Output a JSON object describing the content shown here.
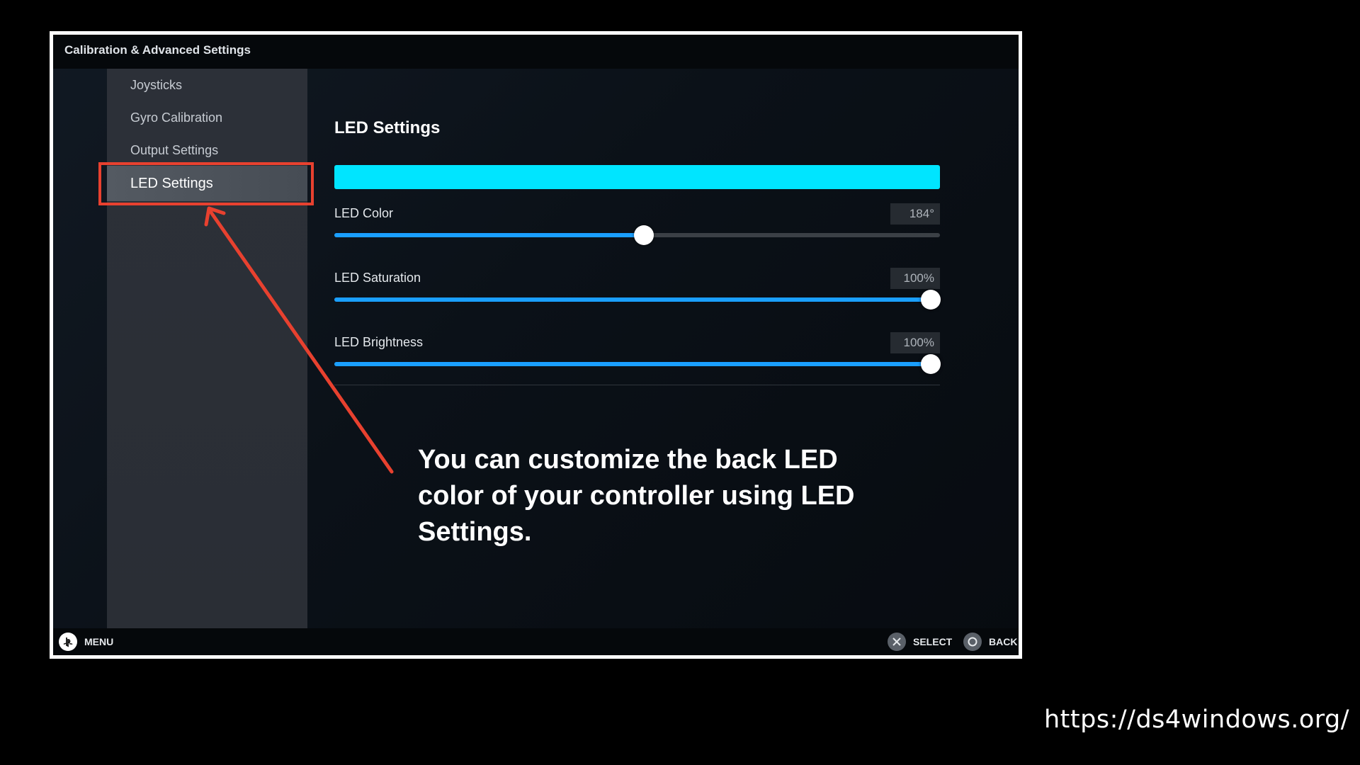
{
  "window": {
    "title": "Calibration & Advanced Settings"
  },
  "sidebar": {
    "items": [
      {
        "label": "Joysticks",
        "active": false
      },
      {
        "label": "Gyro Calibration",
        "active": false
      },
      {
        "label": "Output Settings",
        "active": false
      },
      {
        "label": "LED Settings",
        "active": true
      }
    ]
  },
  "main": {
    "section_title": "LED Settings",
    "preview_color": "#00e5ff",
    "sliders": [
      {
        "label": "LED Color",
        "value_text": "184°",
        "fraction": 0.511
      },
      {
        "label": "LED Saturation",
        "value_text": "100%",
        "fraction": 0.985
      },
      {
        "label": "LED Brightness",
        "value_text": "100%",
        "fraction": 0.985
      }
    ]
  },
  "annotation": {
    "caption": "You can customize the back LED color of your controller using LED Settings.",
    "highlight_color": "#e8412f"
  },
  "footer": {
    "menu_label": "MENU",
    "select_label": "SELECT",
    "back_label": "BACK",
    "menu_icon": "playstation-icon",
    "select_icon": "cross-button-icon",
    "back_icon": "circle-button-icon"
  },
  "watermark": {
    "url": "https://ds4windows.org/"
  },
  "colors": {
    "accent": "#1a9fff",
    "sidebar_bg": "#2c3038",
    "active_item_bg": "#545a62"
  }
}
